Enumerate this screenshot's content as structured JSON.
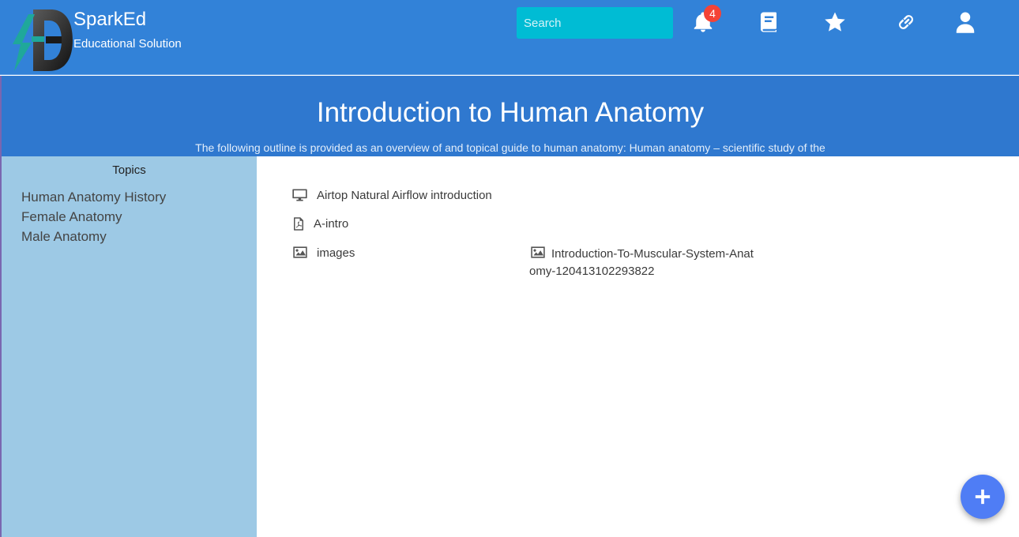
{
  "brand": {
    "name": "SparkEd",
    "tagline": "Educational Solution"
  },
  "search": {
    "placeholder": "Search",
    "value": ""
  },
  "nav": {
    "notifications_count": "4",
    "icons": [
      "bell-icon",
      "book-icon",
      "star-icon",
      "link-icon",
      "user-icon"
    ]
  },
  "hero": {
    "title": "Introduction to Human Anatomy",
    "description": "The following outline is provided as an overview of and topical guide to human anatomy: Human anatomy – scientific study of the"
  },
  "sidebar": {
    "title": "Topics",
    "topics": [
      {
        "label": "Human Anatomy History"
      },
      {
        "label": "Female Anatomy"
      },
      {
        "label": "Male Anatomy"
      }
    ]
  },
  "content": {
    "items": [
      {
        "label": "Airtop Natural Airflow introduction",
        "icon": "monitor-icon"
      },
      {
        "label": "A-intro",
        "icon": "pdf-icon"
      },
      {
        "label": "images",
        "icon": "image-icon"
      },
      {
        "label": "Introduction-To-Muscular-System-Anatomy-120413102293822",
        "icon": "image-icon"
      }
    ]
  },
  "colors": {
    "navbar": "#3282d8",
    "hero": "#2f78cf",
    "sidebar": "#9dc9e5",
    "search": "#00bcd4",
    "badge": "#f44336",
    "fab": "#4f7df5"
  },
  "fab": {
    "icon": "plus-icon"
  }
}
